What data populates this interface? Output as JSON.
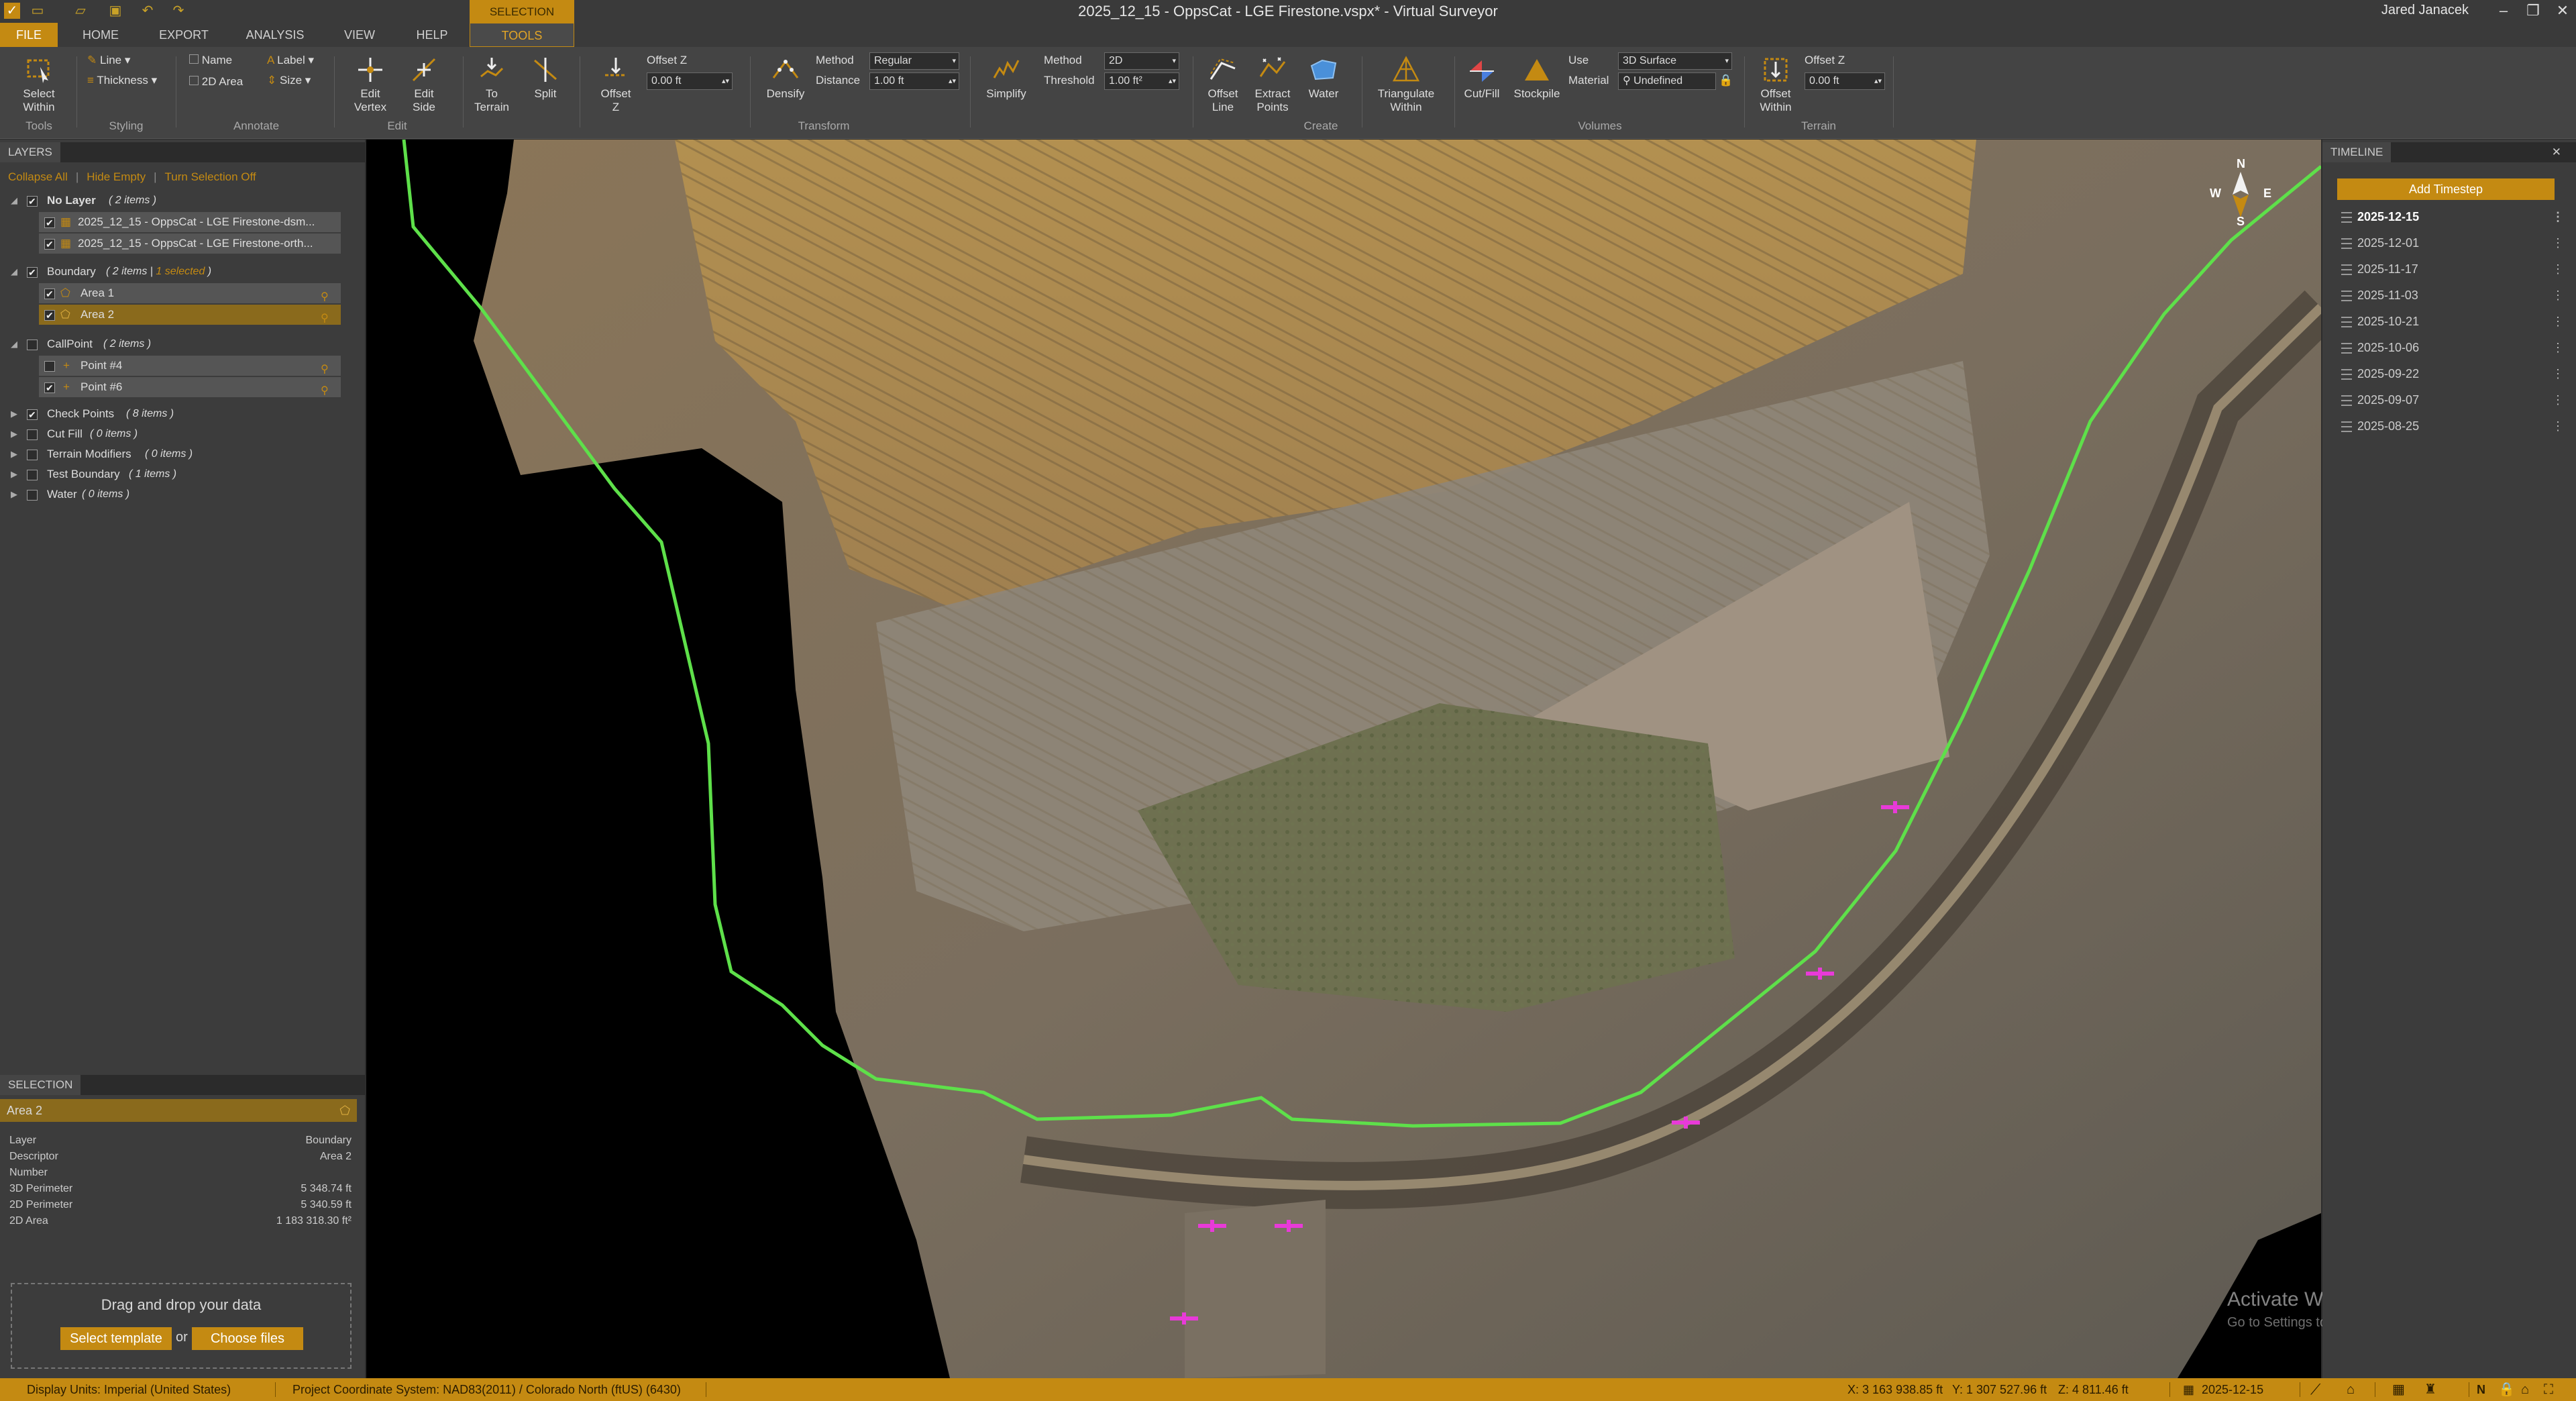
{
  "window": {
    "title": "2025_12_15 - OppsCat - LGE Firestone.vspx* - Virtual Surveyor",
    "user": "Jared Janacek",
    "context_group": "SELECTION",
    "controls": [
      "minimize-icon",
      "maximize-icon",
      "close-icon"
    ]
  },
  "tabs": {
    "file": "FILE",
    "home": "HOME",
    "export": "EXPORT",
    "analysis": "ANALYSIS",
    "view": "VIEW",
    "help": "HELP",
    "tools": "TOOLS"
  },
  "ribbon": {
    "tools": {
      "select_within": "Select Within",
      "group": "Tools"
    },
    "styling": {
      "line": "Line",
      "thickness": "Thickness",
      "group": "Styling"
    },
    "annotate": {
      "name": "Name",
      "label": "Label",
      "area2d": "2D Area",
      "size": "Size",
      "group": "Annotate"
    },
    "edit": {
      "edit_vertex": "Edit Vertex",
      "edit_side": "Edit Side",
      "group": "Edit"
    },
    "transform": {
      "to_terrain": "To Terrain",
      "split": "Split",
      "offset_z": "Offset Z",
      "offset_z_label": "Offset Z",
      "offset_z_value": "0.00 ft",
      "densify": "Densify",
      "method_label": "Method",
      "method_value": "Regular",
      "distance_label": "Distance",
      "distance_value": "1.00 ft",
      "simplify": "Simplify",
      "s_method_label": "Method",
      "s_method_value": "2D",
      "threshold_label": "Threshold",
      "threshold_value": "1.00 ft²",
      "group": "Transform"
    },
    "create": {
      "offset_line": "Offset Line",
      "extract_points": "Extract Points",
      "water": "Water",
      "triangulate_within": "Triangulate Within",
      "group": "Create"
    },
    "volumes": {
      "cut_fill": "Cut/Fill",
      "stockpile": "Stockpile",
      "use_label": "Use",
      "use_value": "3D Surface",
      "material_label": "Material",
      "material_value": "Undefined",
      "group": "Volumes"
    },
    "terrain": {
      "offset_within": "Offset Within",
      "offset_z_label": "Offset Z",
      "offset_z_value": "0.00 ft",
      "group": "Terrain"
    }
  },
  "layers": {
    "title": "LAYERS",
    "collapse_all": "Collapse All",
    "hide_empty": "Hide Empty",
    "turn_selection_off": "Turn Selection Off",
    "groups": [
      {
        "name": "No Layer",
        "count": "( 2 items )",
        "checked": true,
        "expanded": true,
        "children": [
          {
            "name": "2025_12_15 - OppsCat - LGE Firestone-dsm...",
            "checked": true
          },
          {
            "name": "2025_12_15 - OppsCat - LGE Firestone-orth...",
            "checked": true
          }
        ]
      },
      {
        "name": "Boundary",
        "count": "( 2 items |",
        "selected_note": "1 selected",
        "count_close": ")",
        "checked": true,
        "expanded": true,
        "children": [
          {
            "name": "Area 1",
            "checked": true
          },
          {
            "name": "Area 2",
            "checked": true,
            "selected": true
          }
        ]
      },
      {
        "name": "CallPoint",
        "count": "( 2 items )",
        "checked": false,
        "expanded": true,
        "children": [
          {
            "name": "Point #4",
            "checked": false
          },
          {
            "name": "Point #6",
            "checked": true
          }
        ]
      },
      {
        "name": "Check Points",
        "count": "( 8 items )",
        "checked": true
      },
      {
        "name": "Cut Fill",
        "count": "( 0 items )",
        "checked": false
      },
      {
        "name": "Terrain Modifiers",
        "count": "( 0 items )",
        "checked": false
      },
      {
        "name": "Test Boundary",
        "count": "( 1 items )",
        "checked": false
      },
      {
        "name": "Water",
        "count": "( 0 items )",
        "checked": false
      }
    ]
  },
  "selection": {
    "title": "SELECTION",
    "name": "Area 2",
    "props": [
      {
        "k": "Layer",
        "v": "Boundary"
      },
      {
        "k": "Descriptor",
        "v": "Area 2"
      },
      {
        "k": "Number",
        "v": ""
      },
      {
        "k": "3D Perimeter",
        "v": "5 348.74 ft"
      },
      {
        "k": "2D Perimeter",
        "v": "5 340.59 ft"
      },
      {
        "k": "2D Area",
        "v": "1 183 318.30 ft²"
      }
    ]
  },
  "dropzone": {
    "text": "Drag and drop your data",
    "select_template": "Select template",
    "or": "or",
    "choose_files": "Choose files"
  },
  "timeline": {
    "title": "TIMELINE",
    "add": "Add Timestep",
    "dates": [
      "2025-12-15",
      "2025-12-01",
      "2025-11-17",
      "2025-11-03",
      "2025-10-21",
      "2025-10-06",
      "2025-09-22",
      "2025-09-07",
      "2025-08-25"
    ]
  },
  "compass": {
    "n": "N",
    "s": "S",
    "e": "E",
    "w": "W"
  },
  "watermark": {
    "line1": "Activate Windows",
    "line2": "Go to Settings to activate Windows."
  },
  "status": {
    "display_units": "Display Units:  Imperial (United States)",
    "crs": "Project Coordinate System:  NAD83(2011) / Colorado North (ftUS) (6430)",
    "x": "X: 3 163 938.85 ft",
    "y": "Y: 1 307 527.96 ft",
    "z": "Z: 4 811.46 ft",
    "date": "2025-12-15"
  },
  "colors": {
    "accent": "#c48a12",
    "boundary_line": "#5ee04a",
    "point_marker": "#e83ad8"
  }
}
